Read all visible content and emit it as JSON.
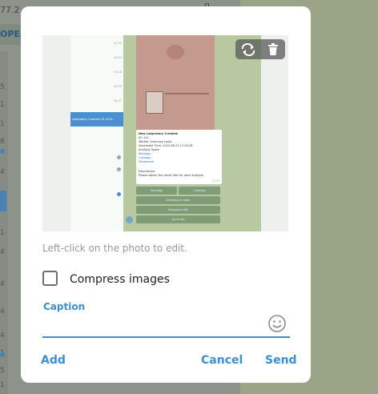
{
  "background": {
    "top_value": "77.2",
    "open_tab": "OPEN",
    "top_page": "g",
    "strip_digits": [
      "5",
      "1",
      "1",
      "8",
      "4",
      "1",
      "4",
      "4",
      "4",
      "4",
      "1",
      "5",
      "1"
    ]
  },
  "photo": {
    "mini_list_rows": [
      {
        "text": "",
        "time": "15:30"
      },
      {
        "text": "",
        "time": "18:53"
      },
      {
        "text": "",
        "time": "15:18"
      },
      {
        "text": "",
        "time": "18:09"
      },
      {
        "text": "",
        "time": "18:47"
      }
    ],
    "selected_row_text": "Laboratory Created: ID 1010...",
    "card_lines": [
      "New Laboratory Created:",
      "ID: 101",
      "Worker: Ashurova Layla",
      "Scheduled Time: 2024-08-23 17:00:28",
      "Analysis Types:",
      "Serology",
      "Cytology",
      "Ultrasound",
      "",
      "Description:",
      "Please attach the result files for each analysis."
    ],
    "card_time": "17:05",
    "buttons": [
      "Serology",
      "Cytology",
      "Ultrasound video",
      "Ultrasound file",
      "Go to list"
    ]
  },
  "icons": {
    "rotate": "rotate-icon",
    "delete": "trash-icon",
    "emoji": "emoji-icon"
  },
  "dialog": {
    "hint": "Left-click on the photo to edit.",
    "compress_label": "Compress images",
    "compress_checked": false,
    "caption_label": "Caption",
    "caption_value": "",
    "add_label": "Add",
    "cancel_label": "Cancel",
    "send_label": "Send"
  },
  "colors": {
    "accent": "#3d8fce",
    "hint": "#999999"
  }
}
